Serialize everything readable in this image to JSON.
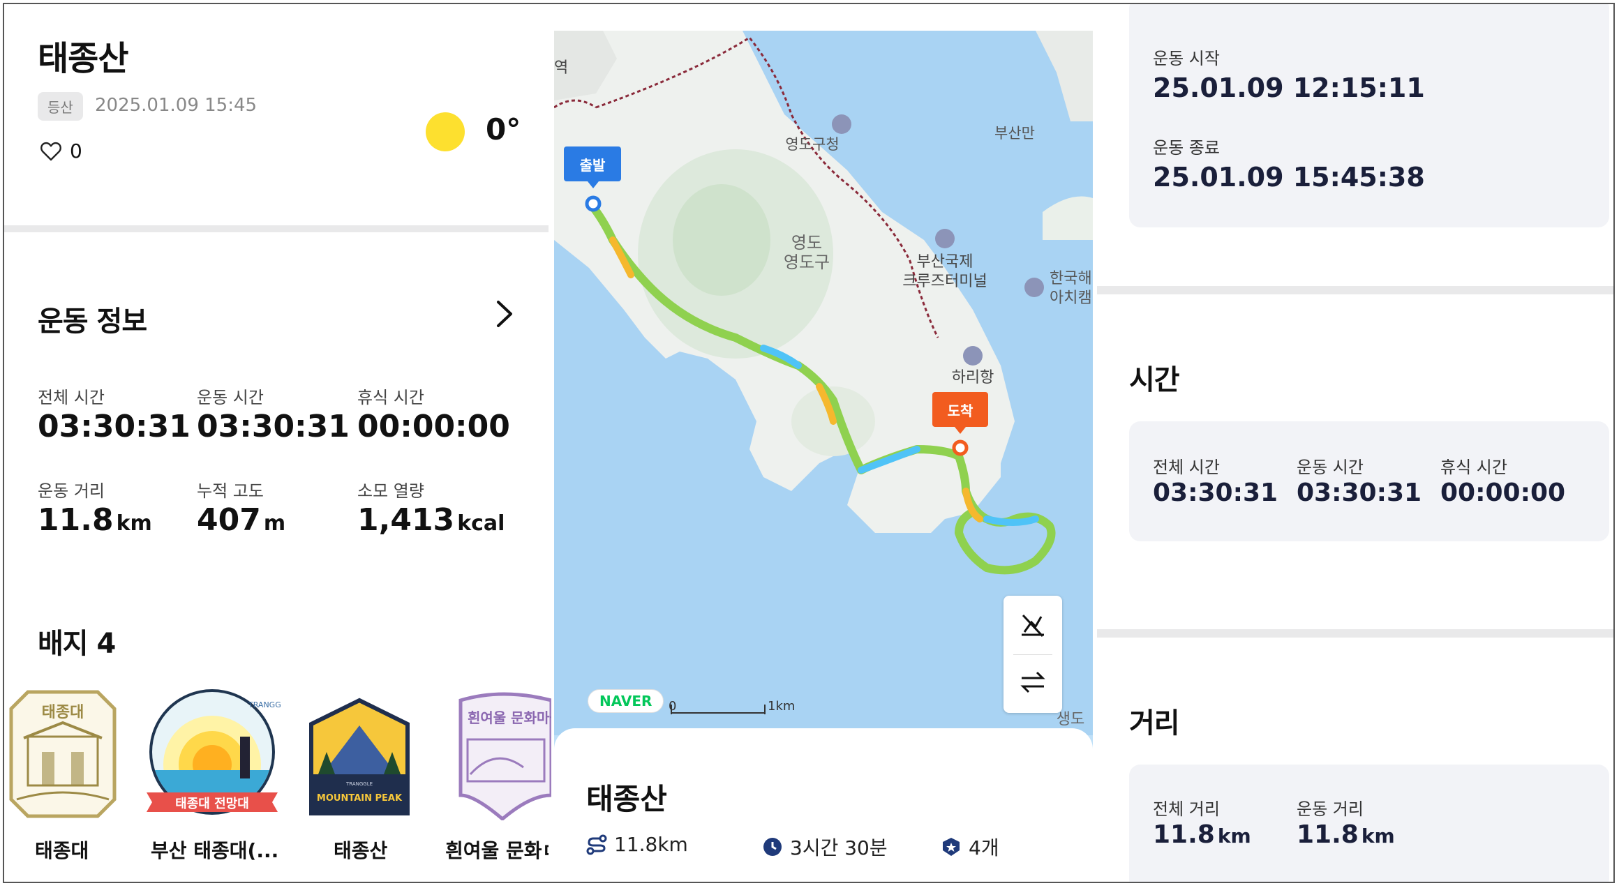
{
  "summary": {
    "title": "태종산",
    "activity_tag": "등산",
    "datetime": "2025.01.09 15:45",
    "likes": "0",
    "temperature": "0°"
  },
  "exercise_info": {
    "title": "운동 정보",
    "stats": [
      {
        "label": "전체 시간",
        "value": "03:30:31",
        "unit": ""
      },
      {
        "label": "운동 시간",
        "value": "03:30:31",
        "unit": ""
      },
      {
        "label": "휴식 시간",
        "value": "00:00:00",
        "unit": ""
      },
      {
        "label": "운동 거리",
        "value": "11.8",
        "unit": "km"
      },
      {
        "label": "누적 고도",
        "value": "407",
        "unit": "m"
      },
      {
        "label": "소모 열량",
        "value": "1,413",
        "unit": "kcal"
      }
    ]
  },
  "badges": {
    "title": "배지 4",
    "items": [
      {
        "name": "태종대",
        "stamp_text": "태종대"
      },
      {
        "name": "부산 태종대(...",
        "stamp_text": "태종대 전망대",
        "ring_text": "TRANGGLE"
      },
      {
        "name": "태종산",
        "stamp_text": "MOUNTAIN PEAK",
        "small_text": "TRANGGLE"
      },
      {
        "name": "흰여울 문화ㅁ",
        "stamp_text": "흰여울 문화마을"
      }
    ]
  },
  "map": {
    "labels": {
      "yeongdo_gucheong": "영도구청",
      "busan_port": "부산만",
      "yeongdo": "영도",
      "yeongdo_gu": "영도구",
      "terminal_1": "부산국제",
      "terminal_2": "크루즈터미널",
      "univ_1": "한국해",
      "univ_2": "아치캠",
      "harihang": "하리항",
      "saengdo": "생도",
      "edge_char": "역"
    },
    "start_label": "출발",
    "end_label": "도착",
    "provider": "NAVER",
    "scale_start": "0",
    "scale_end": "1km",
    "route_colors": [
      "#8fd14f",
      "#f5b82e",
      "#4fc3f7"
    ],
    "start_color": "#2a7be4",
    "end_color": "#f25c1f"
  },
  "sheet": {
    "title": "태종산",
    "distance": "11.8km",
    "duration": "3시간 30분",
    "badge_count": "4개"
  },
  "right": {
    "start_label": "운동 시작",
    "start_value": "25.01.09 12:15:11",
    "end_label": "운동 종료",
    "end_value": "25.01.09 15:45:38",
    "time_title": "시간",
    "time_stats": [
      {
        "label": "전체 시간",
        "value": "03:30:31"
      },
      {
        "label": "운동 시간",
        "value": "03:30:31"
      },
      {
        "label": "휴식 시간",
        "value": "00:00:00"
      }
    ],
    "distance_title": "거리",
    "distance_stats": [
      {
        "label": "전체 거리",
        "value": "11.8",
        "unit": "km"
      },
      {
        "label": "운동 거리",
        "value": "11.8",
        "unit": "km"
      }
    ]
  }
}
